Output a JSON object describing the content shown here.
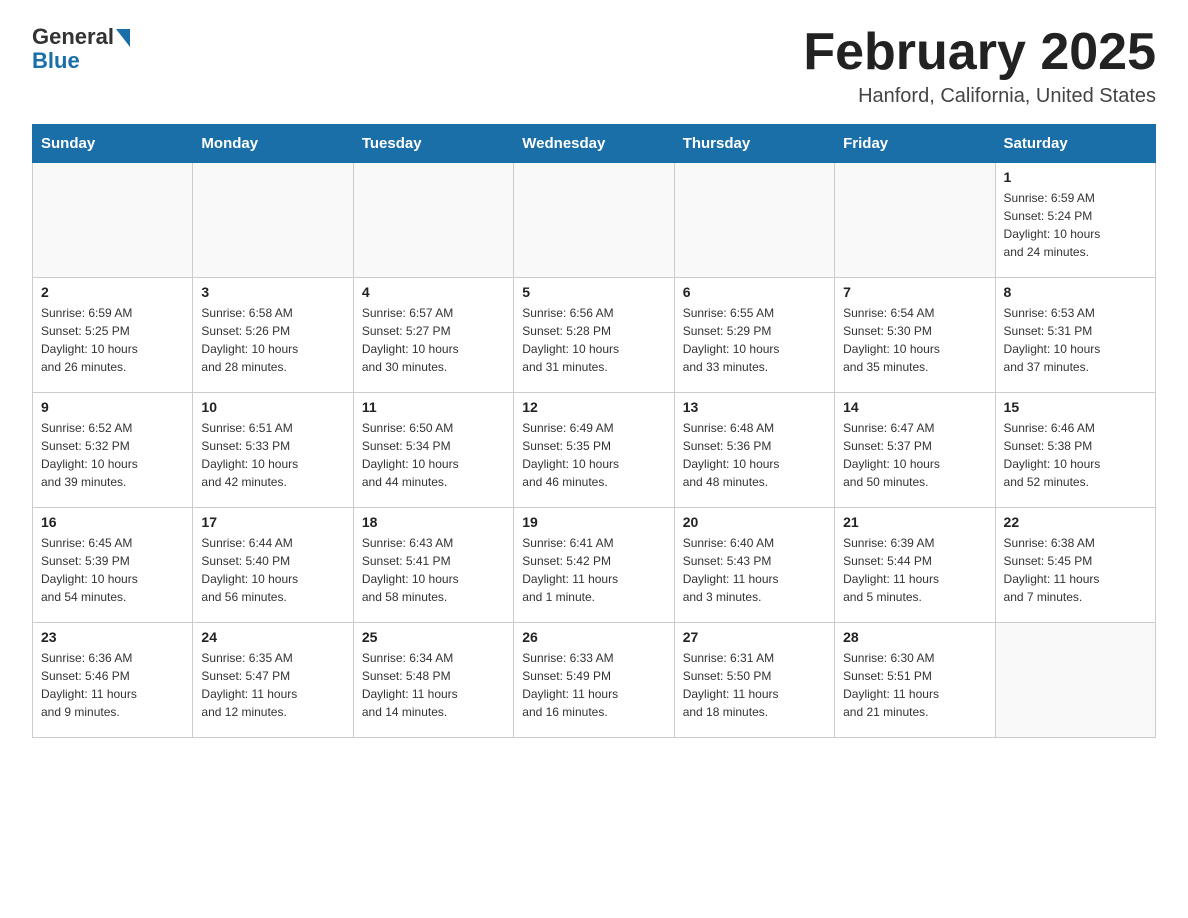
{
  "header": {
    "logo_general": "General",
    "logo_blue": "Blue",
    "month_title": "February 2025",
    "location": "Hanford, California, United States"
  },
  "days_of_week": [
    "Sunday",
    "Monday",
    "Tuesday",
    "Wednesday",
    "Thursday",
    "Friday",
    "Saturday"
  ],
  "weeks": [
    [
      {
        "day": "",
        "info": ""
      },
      {
        "day": "",
        "info": ""
      },
      {
        "day": "",
        "info": ""
      },
      {
        "day": "",
        "info": ""
      },
      {
        "day": "",
        "info": ""
      },
      {
        "day": "",
        "info": ""
      },
      {
        "day": "1",
        "info": "Sunrise: 6:59 AM\nSunset: 5:24 PM\nDaylight: 10 hours\nand 24 minutes."
      }
    ],
    [
      {
        "day": "2",
        "info": "Sunrise: 6:59 AM\nSunset: 5:25 PM\nDaylight: 10 hours\nand 26 minutes."
      },
      {
        "day": "3",
        "info": "Sunrise: 6:58 AM\nSunset: 5:26 PM\nDaylight: 10 hours\nand 28 minutes."
      },
      {
        "day": "4",
        "info": "Sunrise: 6:57 AM\nSunset: 5:27 PM\nDaylight: 10 hours\nand 30 minutes."
      },
      {
        "day": "5",
        "info": "Sunrise: 6:56 AM\nSunset: 5:28 PM\nDaylight: 10 hours\nand 31 minutes."
      },
      {
        "day": "6",
        "info": "Sunrise: 6:55 AM\nSunset: 5:29 PM\nDaylight: 10 hours\nand 33 minutes."
      },
      {
        "day": "7",
        "info": "Sunrise: 6:54 AM\nSunset: 5:30 PM\nDaylight: 10 hours\nand 35 minutes."
      },
      {
        "day": "8",
        "info": "Sunrise: 6:53 AM\nSunset: 5:31 PM\nDaylight: 10 hours\nand 37 minutes."
      }
    ],
    [
      {
        "day": "9",
        "info": "Sunrise: 6:52 AM\nSunset: 5:32 PM\nDaylight: 10 hours\nand 39 minutes."
      },
      {
        "day": "10",
        "info": "Sunrise: 6:51 AM\nSunset: 5:33 PM\nDaylight: 10 hours\nand 42 minutes."
      },
      {
        "day": "11",
        "info": "Sunrise: 6:50 AM\nSunset: 5:34 PM\nDaylight: 10 hours\nand 44 minutes."
      },
      {
        "day": "12",
        "info": "Sunrise: 6:49 AM\nSunset: 5:35 PM\nDaylight: 10 hours\nand 46 minutes."
      },
      {
        "day": "13",
        "info": "Sunrise: 6:48 AM\nSunset: 5:36 PM\nDaylight: 10 hours\nand 48 minutes."
      },
      {
        "day": "14",
        "info": "Sunrise: 6:47 AM\nSunset: 5:37 PM\nDaylight: 10 hours\nand 50 minutes."
      },
      {
        "day": "15",
        "info": "Sunrise: 6:46 AM\nSunset: 5:38 PM\nDaylight: 10 hours\nand 52 minutes."
      }
    ],
    [
      {
        "day": "16",
        "info": "Sunrise: 6:45 AM\nSunset: 5:39 PM\nDaylight: 10 hours\nand 54 minutes."
      },
      {
        "day": "17",
        "info": "Sunrise: 6:44 AM\nSunset: 5:40 PM\nDaylight: 10 hours\nand 56 minutes."
      },
      {
        "day": "18",
        "info": "Sunrise: 6:43 AM\nSunset: 5:41 PM\nDaylight: 10 hours\nand 58 minutes."
      },
      {
        "day": "19",
        "info": "Sunrise: 6:41 AM\nSunset: 5:42 PM\nDaylight: 11 hours\nand 1 minute."
      },
      {
        "day": "20",
        "info": "Sunrise: 6:40 AM\nSunset: 5:43 PM\nDaylight: 11 hours\nand 3 minutes."
      },
      {
        "day": "21",
        "info": "Sunrise: 6:39 AM\nSunset: 5:44 PM\nDaylight: 11 hours\nand 5 minutes."
      },
      {
        "day": "22",
        "info": "Sunrise: 6:38 AM\nSunset: 5:45 PM\nDaylight: 11 hours\nand 7 minutes."
      }
    ],
    [
      {
        "day": "23",
        "info": "Sunrise: 6:36 AM\nSunset: 5:46 PM\nDaylight: 11 hours\nand 9 minutes."
      },
      {
        "day": "24",
        "info": "Sunrise: 6:35 AM\nSunset: 5:47 PM\nDaylight: 11 hours\nand 12 minutes."
      },
      {
        "day": "25",
        "info": "Sunrise: 6:34 AM\nSunset: 5:48 PM\nDaylight: 11 hours\nand 14 minutes."
      },
      {
        "day": "26",
        "info": "Sunrise: 6:33 AM\nSunset: 5:49 PM\nDaylight: 11 hours\nand 16 minutes."
      },
      {
        "day": "27",
        "info": "Sunrise: 6:31 AM\nSunset: 5:50 PM\nDaylight: 11 hours\nand 18 minutes."
      },
      {
        "day": "28",
        "info": "Sunrise: 6:30 AM\nSunset: 5:51 PM\nDaylight: 11 hours\nand 21 minutes."
      },
      {
        "day": "",
        "info": ""
      }
    ]
  ]
}
